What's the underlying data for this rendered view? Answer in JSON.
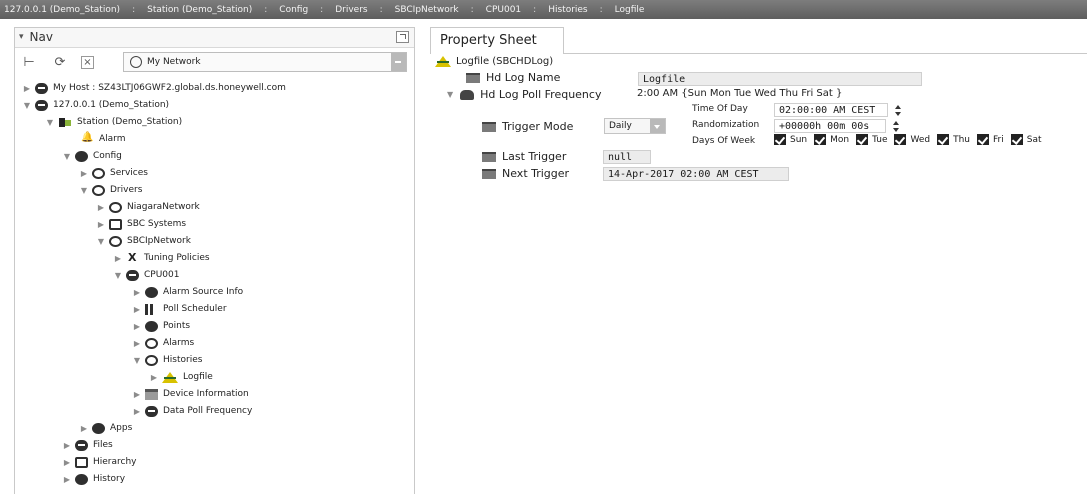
{
  "breadcrumbs": [
    "127.0.0.1 (Demo_Station)",
    "Station (Demo_Station)",
    "Config",
    "Drivers",
    "SBCIpNetwork",
    "CPU001",
    "Histories",
    "Logfile"
  ],
  "breadcrumb_separator": ":",
  "nav": {
    "tab_label": "Nav",
    "network_select": "My Network",
    "tree": [
      {
        "label": "My Host : SZ43LTJ06GWF2.global.ds.honeywell.com",
        "icon": "host-icon",
        "expanded": false
      },
      {
        "label": "127.0.0.1 (Demo_Station)",
        "icon": "station-connection-icon",
        "expanded": true
      },
      {
        "label": "Station (Demo_Station)",
        "icon": "station-icon",
        "expanded": true
      },
      {
        "label": "Alarm",
        "icon": "bell-icon",
        "expanded": null
      },
      {
        "label": "Config",
        "icon": "config-icon",
        "expanded": true
      },
      {
        "label": "Services",
        "icon": "services-icon",
        "expanded": false
      },
      {
        "label": "Drivers",
        "icon": "drivers-icon",
        "expanded": true
      },
      {
        "label": "NiagaraNetwork",
        "icon": "network-icon",
        "expanded": false
      },
      {
        "label": "SBC Systems",
        "icon": "network-icon",
        "expanded": false
      },
      {
        "label": "SBCIpNetwork",
        "icon": "network-icon",
        "expanded": true
      },
      {
        "label": "Tuning Policies",
        "icon": "tuning-icon",
        "expanded": false
      },
      {
        "label": "CPU001",
        "icon": "device-icon",
        "expanded": true
      },
      {
        "label": "Alarm Source Info",
        "icon": "alarm-source-icon",
        "expanded": false
      },
      {
        "label": "Poll Scheduler",
        "icon": "poll-scheduler-icon",
        "expanded": false
      },
      {
        "label": "Points",
        "icon": "points-icon",
        "expanded": false
      },
      {
        "label": "Alarms",
        "icon": "alarms-icon",
        "expanded": false
      },
      {
        "label": "Histories",
        "icon": "histories-icon",
        "expanded": true
      },
      {
        "label": "Logfile",
        "icon": "logfile-icon",
        "expanded": false
      },
      {
        "label": "Device Information",
        "icon": "folder-icon",
        "expanded": false
      },
      {
        "label": "Data Poll Frequency",
        "icon": "dial-icon",
        "expanded": false
      },
      {
        "label": "Apps",
        "icon": "apps-icon",
        "expanded": false
      },
      {
        "label": "Files",
        "icon": "files-icon",
        "expanded": false
      },
      {
        "label": "Hierarchy",
        "icon": "hierarchy-icon",
        "expanded": false
      },
      {
        "label": "History",
        "icon": "history-icon",
        "expanded": false
      }
    ]
  },
  "property_sheet": {
    "tab_label": "Property Sheet",
    "root_label": "Logfile  (SBCHDLog)",
    "log_name_label": "Hd Log Name",
    "log_name_value": "Logfile",
    "poll_freq_label": "Hd Log Poll Frequency",
    "poll_freq_value": "2:00 AM {Sun Mon Tue Wed Thu Fri Sat }",
    "trigger_mode_label": "Trigger Mode",
    "trigger_mode_value": "Daily",
    "time_of_day_label": "Time Of Day",
    "time_of_day_value": "02:00:00 AM CEST",
    "randomization_label": "Randomization",
    "randomization_value": "+00000h 00m 00s",
    "days_of_week_label": "Days Of Week",
    "days": [
      {
        "label": "Sun",
        "checked": true
      },
      {
        "label": "Mon",
        "checked": true
      },
      {
        "label": "Tue",
        "checked": true
      },
      {
        "label": "Wed",
        "checked": true
      },
      {
        "label": "Thu",
        "checked": true
      },
      {
        "label": "Fri",
        "checked": true
      },
      {
        "label": "Sat",
        "checked": true
      }
    ],
    "last_trigger_label": "Last Trigger",
    "last_trigger_value": "null",
    "next_trigger_label": "Next Trigger",
    "next_trigger_value": "14-Apr-2017 02:00 AM CEST"
  }
}
